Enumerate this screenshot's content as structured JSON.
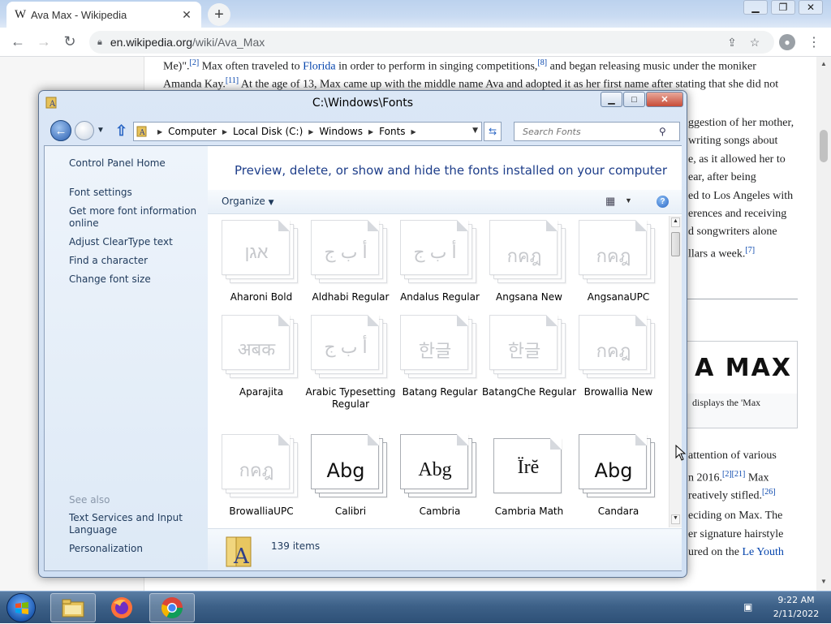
{
  "browser": {
    "tab_icon": "W",
    "tab_title": "Ava Max - Wikipedia",
    "tab_close": "✕",
    "new_tab": "+",
    "url_domain": "en.wikipedia.org",
    "url_path": "/wiki/Ava_Max",
    "icons": [
      "back-icon",
      "forward-icon",
      "reload-icon",
      "lock-icon",
      "share-icon",
      "star-icon",
      "profile-icon",
      "menu-icon"
    ]
  },
  "wiki": {
    "line1_pre": "Me)\".",
    "line1_ref1": "[2]",
    "line1_mid": " Max often traveled to ",
    "line1_link": "Florida",
    "line1_post": " in order to perform in singing competitions,",
    "line1_ref2": "[8]",
    "line1_end": " and began releasing music under the moniker",
    "line2_pre": "Amanda Kay.",
    "line2_ref": "[11]",
    "line2_post": " At the age of 13, Max came up with the middle name Ava and adopted it as her first name after stating that she did not",
    "right_lines": [
      "ggestion of her mother,",
      "writing songs about",
      "e, as it allowed her to",
      "ear, after being",
      "ed to Los Angeles with",
      "erences and receiving",
      "d songwriters alone",
      "llars a week."
    ],
    "right_ref": "[7]",
    "logo_text": "A MAX",
    "logo_caption": "displays the 'Max",
    "lower_lines": {
      "l1": "attention of various",
      "l2_pre": "n 2016.",
      "l2_ref": "[2][21]",
      "l2_post": " Max",
      "l3_pre": "reatively stifled.",
      "l3_ref": "[26]",
      "l4": "eciding on Max. The",
      "l5": "er signature hairstyle",
      "l6_pre": "ured on the ",
      "l6_link": "Le Youth"
    }
  },
  "explorer": {
    "title": "C:\\Windows\\Fonts",
    "breadcrumb": [
      "Computer",
      "Local Disk (C:)",
      "Windows",
      "Fonts"
    ],
    "search_placeholder": "Search Fonts",
    "nav_links": {
      "control_panel_home": "Control Panel Home",
      "font_settings": "Font settings",
      "get_more_info": "Get more font information online",
      "adjust_cleartype": "Adjust ClearType text",
      "find_character": "Find a character",
      "change_font_size": "Change font size"
    },
    "see_also_label": "See also",
    "see_also_links": {
      "text_services": "Text Services and Input Language",
      "personalization": "Personalization"
    },
    "header": "Preview, delete, or show and hide the fonts installed on your computer",
    "organize_label": "Organize",
    "fonts": [
      {
        "name": "Aharoni Bold",
        "preview": "אגן"
      },
      {
        "name": "Aldhabi Regular",
        "preview": "أ ب ج"
      },
      {
        "name": "Andalus Regular",
        "preview": "أ ب ج"
      },
      {
        "name": "Angsana New",
        "preview": "กคฎ"
      },
      {
        "name": "AngsanaUPC",
        "preview": "กคฎ"
      },
      {
        "name": "Aparajita",
        "preview": "अबक"
      },
      {
        "name": "Arabic Typesetting Regular",
        "preview": "أ ب ج"
      },
      {
        "name": "Batang Regular",
        "preview": "한글"
      },
      {
        "name": "BatangChe Regular",
        "preview": "한글"
      },
      {
        "name": "Browallia New",
        "preview": "กคฎ"
      },
      {
        "name": "BrowalliaUPC",
        "preview": "กคฎ"
      },
      {
        "name": "Calibri",
        "preview": "Abg"
      },
      {
        "name": "Cambria",
        "preview": "Abg"
      },
      {
        "name": "Cambria Math",
        "preview": "Ïrĕ"
      },
      {
        "name": "Candara",
        "preview": "Abg"
      }
    ],
    "item_count": "139 items"
  },
  "taskbar": {
    "time": "9:22 AM",
    "date": "2/11/2022",
    "apps": [
      "file-explorer-icon",
      "firefox-icon",
      "chrome-icon"
    ]
  },
  "colors": {
    "link_blue": "#0645ad",
    "explorer_header": "#1e3e8a",
    "taskbar": "#3d6188"
  }
}
